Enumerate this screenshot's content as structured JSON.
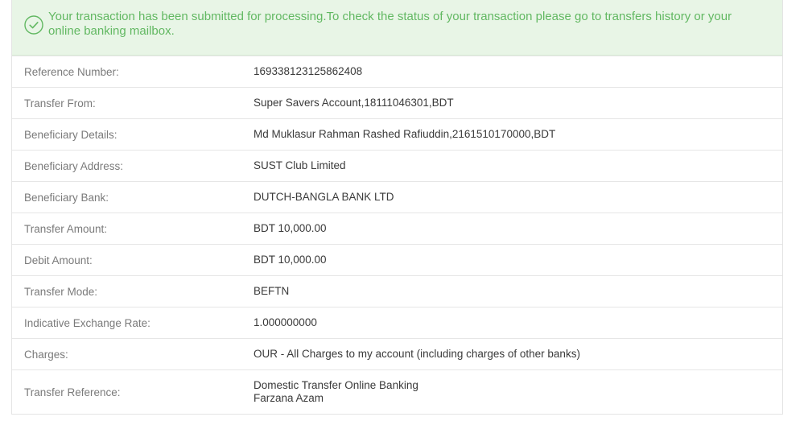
{
  "alert": {
    "icon": "check-circle-icon",
    "color": "#62b862",
    "message": "Your transaction has been submitted for processing.To check the status of your transaction please go to transfers history or your online banking mailbox."
  },
  "details": [
    {
      "label": "Reference Number:",
      "value": "169338123125862408"
    },
    {
      "label": "Transfer From:",
      "value": "Super Savers Account,18111046301,BDT"
    },
    {
      "label": "Beneficiary Details:",
      "value": "Md Muklasur Rahman Rashed Rafiuddin,2161510170000,BDT"
    },
    {
      "label": "Beneficiary Address:",
      "value": "SUST Club Limited"
    },
    {
      "label": "Beneficiary Bank:",
      "value": "DUTCH-BANGLA BANK LTD"
    },
    {
      "label": "Transfer Amount:",
      "value": "BDT 10,000.00"
    },
    {
      "label": "Debit Amount:",
      "value": "BDT 10,000.00"
    },
    {
      "label": "Transfer Mode:",
      "value": "BEFTN"
    },
    {
      "label": "Indicative Exchange Rate:",
      "value": "1.000000000"
    },
    {
      "label": "Charges:",
      "value": "OUR - All Charges to my account (including charges of other banks)"
    },
    {
      "label": "Transfer Reference:",
      "value_lines": [
        "Domestic Transfer Online Banking",
        "Farzana Azam"
      ]
    }
  ]
}
